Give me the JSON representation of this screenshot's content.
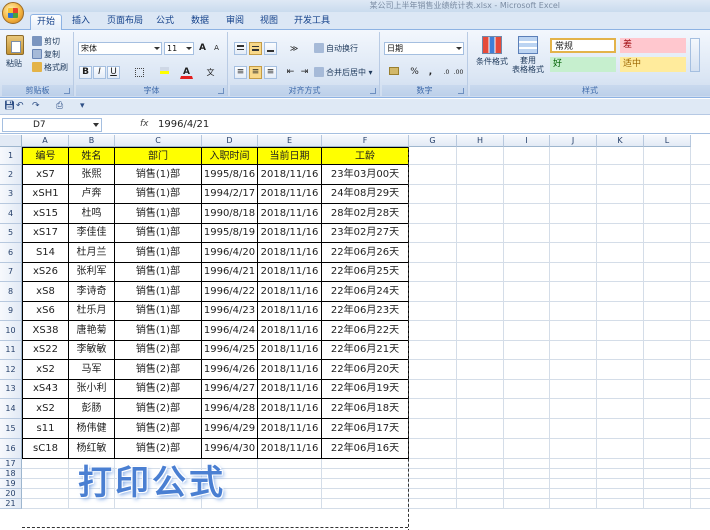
{
  "window": {
    "title": "某公司上半年销售业绩统计表.xlsx - Microsoft Excel"
  },
  "tabs": [
    "开始",
    "插入",
    "页面布局",
    "公式",
    "数据",
    "审阅",
    "视图",
    "开发工具"
  ],
  "ribbon": {
    "clipboard": {
      "paste": "粘贴",
      "cut": "剪切",
      "copy": "复制",
      "format_painter": "格式刷",
      "label": "剪贴板"
    },
    "font": {
      "name": "宋体",
      "size": "11",
      "bold": "B",
      "italic": "I",
      "underline": "U",
      "grow": "A",
      "shrink": "A",
      "font_color_glyph": "A",
      "phonetic_glyph": "文",
      "label": "字体"
    },
    "alignment": {
      "wrap": "自动换行",
      "merge": "合并后居中",
      "label": "对齐方式"
    },
    "number": {
      "format": "日期",
      "percent": "%",
      "comma": ",",
      "label": "数字"
    },
    "styles": {
      "conditional": "条件格式",
      "table_format": "套用\n表格格式",
      "normal": "常规",
      "bad": "差",
      "good": "好",
      "neutral": "适中",
      "label": "样式"
    }
  },
  "formula_bar": {
    "name_box": "D7",
    "fx": "fx",
    "value": "1996/4/21"
  },
  "columns": [
    "A",
    "B",
    "C",
    "D",
    "E",
    "F",
    "G",
    "H",
    "I",
    "J",
    "K",
    "L"
  ],
  "rows": [
    "1",
    "2",
    "3",
    "4",
    "5",
    "6",
    "7",
    "8",
    "9",
    "10",
    "11",
    "12",
    "13",
    "14",
    "15",
    "16",
    "17",
    "18",
    "19",
    "20",
    "21"
  ],
  "table": {
    "headers": [
      "编号",
      "姓名",
      "部门",
      "入职时间",
      "当前日期",
      "工龄"
    ],
    "rows": [
      [
        "xS7",
        "张熙",
        "销售(1)部",
        "1995/8/16",
        "2018/11/16",
        "23年03月00天"
      ],
      [
        "xSH1",
        "卢奔",
        "销售(1)部",
        "1994/2/17",
        "2018/11/16",
        "24年08月29天"
      ],
      [
        "xS15",
        "杜鸣",
        "销售(1)部",
        "1990/8/18",
        "2018/11/16",
        "28年02月28天"
      ],
      [
        "xS17",
        "李佳佳",
        "销售(1)部",
        "1995/8/19",
        "2018/11/16",
        "23年02月27天"
      ],
      [
        "S14",
        "杜月兰",
        "销售(1)部",
        "1996/4/20",
        "2018/11/16",
        "22年06月26天"
      ],
      [
        "xS26",
        "张利军",
        "销售(1)部",
        "1996/4/21",
        "2018/11/16",
        "22年06月25天"
      ],
      [
        "xS8",
        "李诗奇",
        "销售(1)部",
        "1996/4/22",
        "2018/11/16",
        "22年06月24天"
      ],
      [
        "xS6",
        "杜乐月",
        "销售(1)部",
        "1996/4/23",
        "2018/11/16",
        "22年06月23天"
      ],
      [
        "XS38",
        "唐艳菊",
        "销售(1)部",
        "1996/4/24",
        "2018/11/16",
        "22年06月22天"
      ],
      [
        "xS22",
        "李敏敏",
        "销售(2)部",
        "1996/4/25",
        "2018/11/16",
        "22年06月21天"
      ],
      [
        "xS2",
        "马军",
        "销售(2)部",
        "1996/4/26",
        "2018/11/16",
        "22年06月20天"
      ],
      [
        "xS43",
        "张小利",
        "销售(2)部",
        "1996/4/27",
        "2018/11/16",
        "22年06月19天"
      ],
      [
        "xS2",
        "彭肠",
        "销售(2)部",
        "1996/4/28",
        "2018/11/16",
        "22年06月18天"
      ],
      [
        "s11",
        "杨伟健",
        "销售(2)部",
        "1996/4/29",
        "2018/11/16",
        "22年06月17天"
      ],
      [
        "sC18",
        "杨红敏",
        "销售(2)部",
        "1996/4/30",
        "2018/11/16",
        "22年06月16天"
      ]
    ]
  },
  "overlay": {
    "caption": "打印公式"
  },
  "colors": {
    "header_fill": "#ffff00",
    "ribbon": "#dbe6f4",
    "style_bad": "#ffc7ce",
    "style_good": "#c6efce",
    "style_neutral": "#ffeb9c"
  }
}
